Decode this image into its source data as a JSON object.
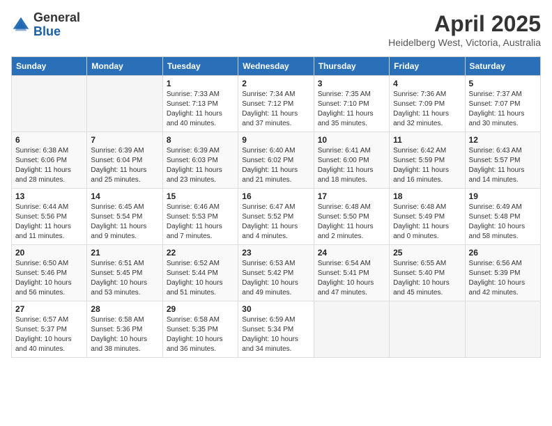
{
  "logo": {
    "general": "General",
    "blue": "Blue"
  },
  "title": "April 2025",
  "subtitle": "Heidelberg West, Victoria, Australia",
  "days_header": [
    "Sunday",
    "Monday",
    "Tuesday",
    "Wednesday",
    "Thursday",
    "Friday",
    "Saturday"
  ],
  "weeks": [
    [
      {
        "num": "",
        "detail": ""
      },
      {
        "num": "",
        "detail": ""
      },
      {
        "num": "1",
        "detail": "Sunrise: 7:33 AM\nSunset: 7:13 PM\nDaylight: 11 hours and 40 minutes."
      },
      {
        "num": "2",
        "detail": "Sunrise: 7:34 AM\nSunset: 7:12 PM\nDaylight: 11 hours and 37 minutes."
      },
      {
        "num": "3",
        "detail": "Sunrise: 7:35 AM\nSunset: 7:10 PM\nDaylight: 11 hours and 35 minutes."
      },
      {
        "num": "4",
        "detail": "Sunrise: 7:36 AM\nSunset: 7:09 PM\nDaylight: 11 hours and 32 minutes."
      },
      {
        "num": "5",
        "detail": "Sunrise: 7:37 AM\nSunset: 7:07 PM\nDaylight: 11 hours and 30 minutes."
      }
    ],
    [
      {
        "num": "6",
        "detail": "Sunrise: 6:38 AM\nSunset: 6:06 PM\nDaylight: 11 hours and 28 minutes."
      },
      {
        "num": "7",
        "detail": "Sunrise: 6:39 AM\nSunset: 6:04 PM\nDaylight: 11 hours and 25 minutes."
      },
      {
        "num": "8",
        "detail": "Sunrise: 6:39 AM\nSunset: 6:03 PM\nDaylight: 11 hours and 23 minutes."
      },
      {
        "num": "9",
        "detail": "Sunrise: 6:40 AM\nSunset: 6:02 PM\nDaylight: 11 hours and 21 minutes."
      },
      {
        "num": "10",
        "detail": "Sunrise: 6:41 AM\nSunset: 6:00 PM\nDaylight: 11 hours and 18 minutes."
      },
      {
        "num": "11",
        "detail": "Sunrise: 6:42 AM\nSunset: 5:59 PM\nDaylight: 11 hours and 16 minutes."
      },
      {
        "num": "12",
        "detail": "Sunrise: 6:43 AM\nSunset: 5:57 PM\nDaylight: 11 hours and 14 minutes."
      }
    ],
    [
      {
        "num": "13",
        "detail": "Sunrise: 6:44 AM\nSunset: 5:56 PM\nDaylight: 11 hours and 11 minutes."
      },
      {
        "num": "14",
        "detail": "Sunrise: 6:45 AM\nSunset: 5:54 PM\nDaylight: 11 hours and 9 minutes."
      },
      {
        "num": "15",
        "detail": "Sunrise: 6:46 AM\nSunset: 5:53 PM\nDaylight: 11 hours and 7 minutes."
      },
      {
        "num": "16",
        "detail": "Sunrise: 6:47 AM\nSunset: 5:52 PM\nDaylight: 11 hours and 4 minutes."
      },
      {
        "num": "17",
        "detail": "Sunrise: 6:48 AM\nSunset: 5:50 PM\nDaylight: 11 hours and 2 minutes."
      },
      {
        "num": "18",
        "detail": "Sunrise: 6:48 AM\nSunset: 5:49 PM\nDaylight: 11 hours and 0 minutes."
      },
      {
        "num": "19",
        "detail": "Sunrise: 6:49 AM\nSunset: 5:48 PM\nDaylight: 10 hours and 58 minutes."
      }
    ],
    [
      {
        "num": "20",
        "detail": "Sunrise: 6:50 AM\nSunset: 5:46 PM\nDaylight: 10 hours and 56 minutes."
      },
      {
        "num": "21",
        "detail": "Sunrise: 6:51 AM\nSunset: 5:45 PM\nDaylight: 10 hours and 53 minutes."
      },
      {
        "num": "22",
        "detail": "Sunrise: 6:52 AM\nSunset: 5:44 PM\nDaylight: 10 hours and 51 minutes."
      },
      {
        "num": "23",
        "detail": "Sunrise: 6:53 AM\nSunset: 5:42 PM\nDaylight: 10 hours and 49 minutes."
      },
      {
        "num": "24",
        "detail": "Sunrise: 6:54 AM\nSunset: 5:41 PM\nDaylight: 10 hours and 47 minutes."
      },
      {
        "num": "25",
        "detail": "Sunrise: 6:55 AM\nSunset: 5:40 PM\nDaylight: 10 hours and 45 minutes."
      },
      {
        "num": "26",
        "detail": "Sunrise: 6:56 AM\nSunset: 5:39 PM\nDaylight: 10 hours and 42 minutes."
      }
    ],
    [
      {
        "num": "27",
        "detail": "Sunrise: 6:57 AM\nSunset: 5:37 PM\nDaylight: 10 hours and 40 minutes."
      },
      {
        "num": "28",
        "detail": "Sunrise: 6:58 AM\nSunset: 5:36 PM\nDaylight: 10 hours and 38 minutes."
      },
      {
        "num": "29",
        "detail": "Sunrise: 6:58 AM\nSunset: 5:35 PM\nDaylight: 10 hours and 36 minutes."
      },
      {
        "num": "30",
        "detail": "Sunrise: 6:59 AM\nSunset: 5:34 PM\nDaylight: 10 hours and 34 minutes."
      },
      {
        "num": "",
        "detail": ""
      },
      {
        "num": "",
        "detail": ""
      },
      {
        "num": "",
        "detail": ""
      }
    ]
  ]
}
